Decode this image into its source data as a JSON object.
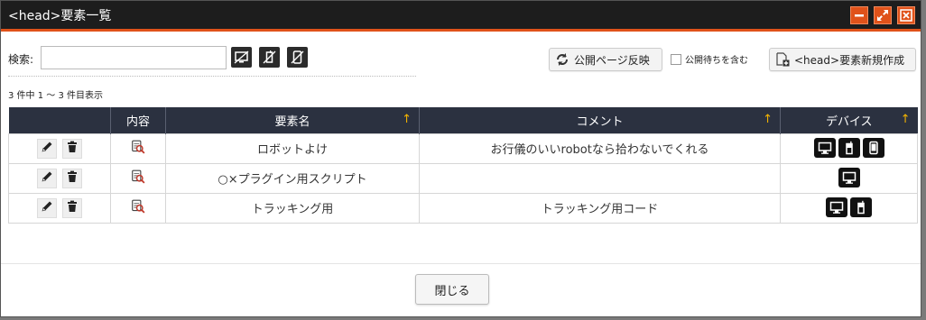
{
  "dialog": {
    "title": "<head>要素一覧"
  },
  "toolbar": {
    "search_label": "検索:",
    "search_value": "",
    "search_placeholder": "",
    "publish_label": "公開ページ反映",
    "include_pending_label": "公開待ちを含む",
    "include_pending_checked": false,
    "new_label": "<head>要素新規作成"
  },
  "count_text": "3 件中 1 ～ 3 件目表示",
  "table": {
    "headers": {
      "content": "内容",
      "name": "要素名",
      "comment": "コメント",
      "device": "デバイス"
    },
    "sort_glyph": "↑",
    "rows": [
      {
        "name": "ロボットよけ",
        "comment": "お行儀のいいrobotなら拾わないでくれる",
        "devices": [
          "desktop-icon",
          "feature-phone-icon",
          "smartphone-icon"
        ]
      },
      {
        "name": "○×プラグイン用スクリプト",
        "comment": "",
        "devices": [
          "desktop-icon"
        ]
      },
      {
        "name": "トラッキング用",
        "comment": "トラッキング用コード",
        "devices": [
          "desktop-icon",
          "feature-phone-icon"
        ]
      }
    ]
  },
  "footer": {
    "close_label": "閉じる"
  },
  "colors": {
    "titlebar": "#1d1d1d",
    "accent": "#e0521a",
    "header": "#2b3140",
    "sort_arrow": "#f4b400"
  }
}
